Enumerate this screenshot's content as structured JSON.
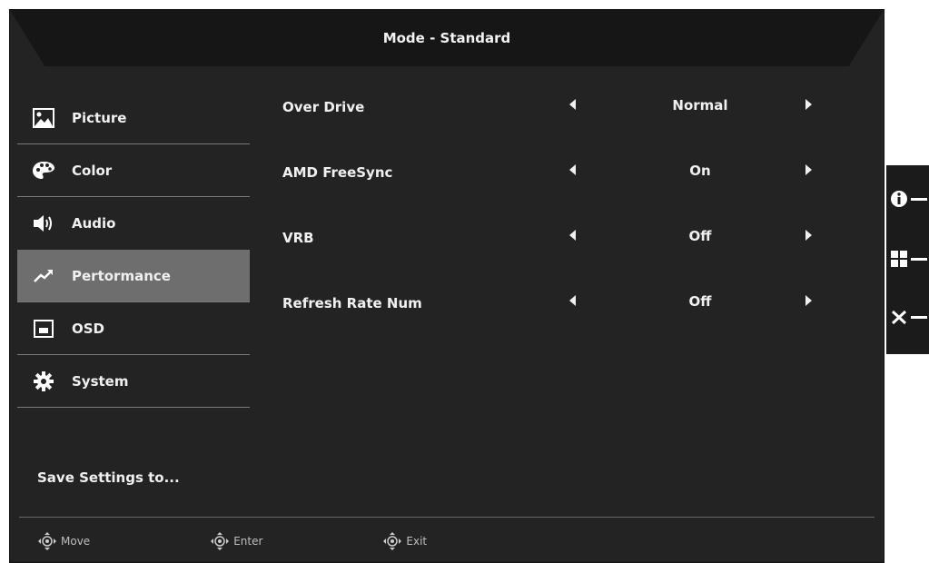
{
  "header": {
    "title": "Mode - Standard"
  },
  "sidebar": {
    "items": [
      {
        "label": "Picture",
        "icon": "picture-icon"
      },
      {
        "label": "Color",
        "icon": "palette-icon"
      },
      {
        "label": "Audio",
        "icon": "speaker-icon"
      },
      {
        "label": "Pertormance",
        "icon": "performance-icon",
        "active": true
      },
      {
        "label": "OSD",
        "icon": "osd-icon"
      },
      {
        "label": "System",
        "icon": "gear-icon"
      }
    ],
    "save_label": "Save Settings to..."
  },
  "settings": [
    {
      "label": "Over Drive",
      "value": "Normal"
    },
    {
      "label": "AMD FreeSync",
      "value": "On"
    },
    {
      "label": "VRB",
      "value": "Off"
    },
    {
      "label": "Refresh Rate Num",
      "value": "Off"
    }
  ],
  "footer": {
    "move": "Move",
    "enter": "Enter",
    "exit": "Exit"
  },
  "side_buttons": [
    "info-icon",
    "grid-icon",
    "close-icon"
  ],
  "colors": {
    "panel": "#232323",
    "header": "#161616",
    "active": "#6e6e6e"
  }
}
